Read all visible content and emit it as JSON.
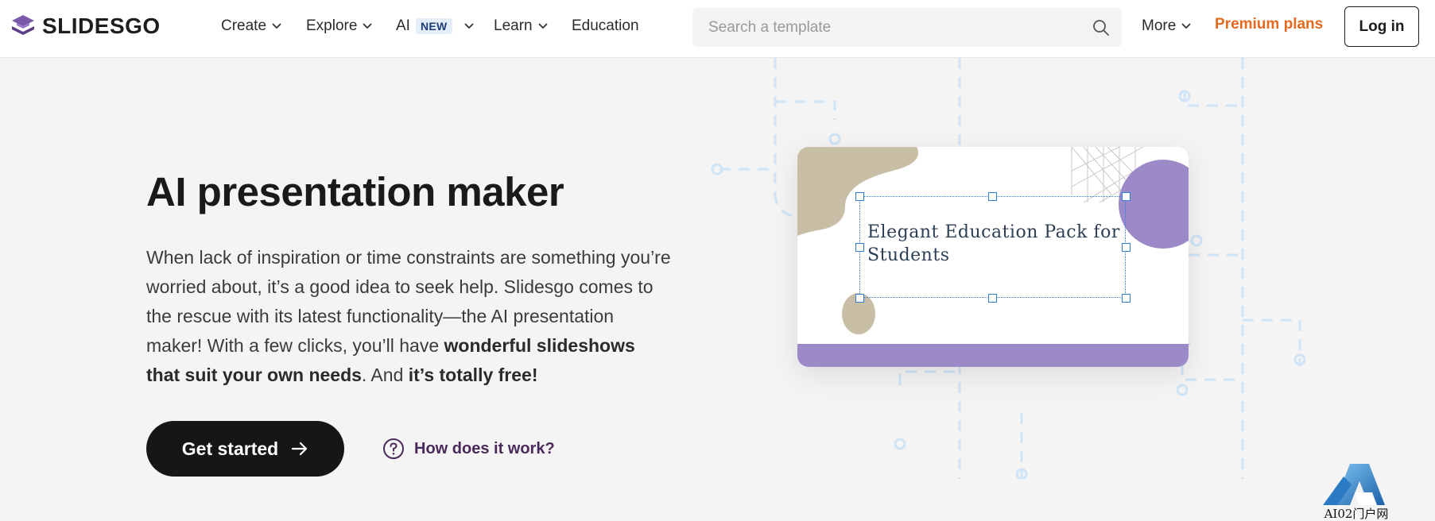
{
  "header": {
    "logo_text": "SLIDESGO",
    "nav": [
      {
        "label": "Create"
      },
      {
        "label": "Explore"
      },
      {
        "label": "AI",
        "badge": "NEW"
      },
      {
        "label": "Learn"
      },
      {
        "label": "Education"
      }
    ],
    "search": {
      "placeholder": "Search a template",
      "value": ""
    },
    "more_label": "More",
    "premium_label": "Premium plans",
    "login_label": "Log in"
  },
  "hero": {
    "title": "AI presentation maker",
    "desc_1": "When lack of inspiration or time constraints are something you’re worried about, it’s a good idea to seek help. Slidesgo comes to the rescue with its latest functionality—the AI presentation maker! With a few clicks, you’ll have ",
    "desc_bold_1": "wonderful slideshows that suit your own needs",
    "desc_2": ". And ",
    "desc_bold_2": "it’s totally free!",
    "cta_label": "Get started",
    "how_label": "How does it work?"
  },
  "illustration": {
    "slide_title": "Elegant Education Pack for Students"
  },
  "watermark": {
    "text": "AI02门户网"
  },
  "colors": {
    "brand_purple": "#6b4f9a",
    "premium_orange": "#e36a1f",
    "link_purple": "#4a2a5a",
    "circuit_blue": "#cfe4f6",
    "selection_blue": "#2f7fd6",
    "slide_beige": "#c8bda5",
    "slide_lilac": "#9b8ac7"
  },
  "icons": {
    "logo": "slidesgo-logo-icon",
    "search": "search-icon",
    "chevron": "chevron-down-icon",
    "arrow": "arrow-right-icon",
    "help": "question-circle-icon"
  }
}
